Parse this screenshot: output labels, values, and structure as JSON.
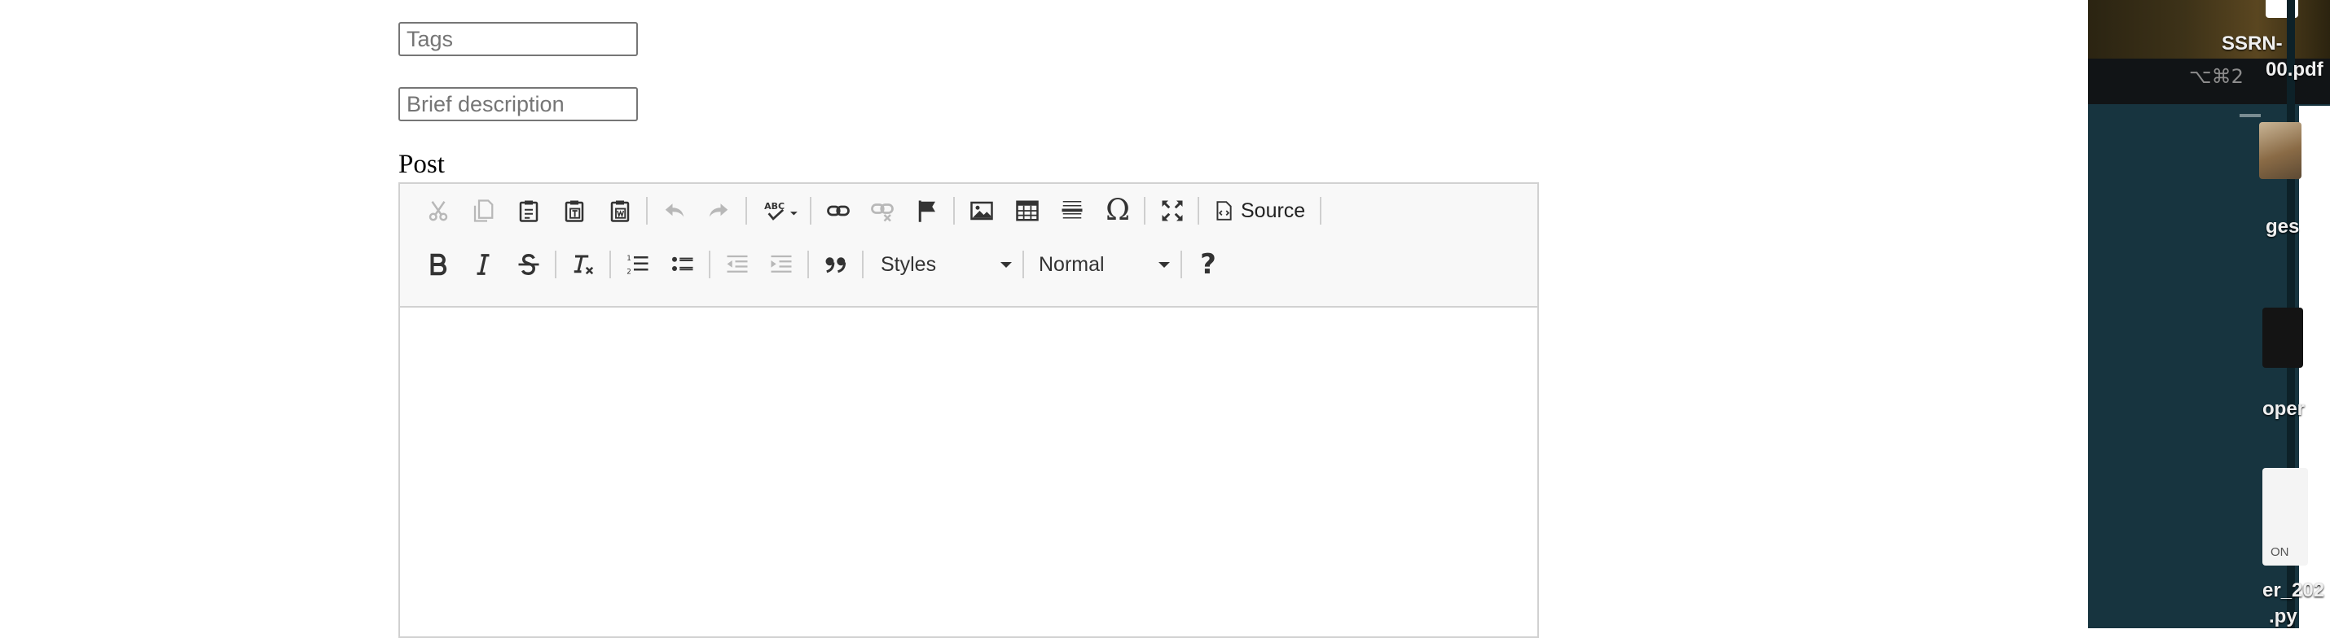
{
  "form": {
    "tags_placeholder": "Tags",
    "description_placeholder": "Brief description",
    "post_label": "Post"
  },
  "editor": {
    "toolbar_row1": [
      {
        "icon": "cut-icon",
        "disabled": true
      },
      {
        "icon": "copy-icon",
        "disabled": true
      },
      {
        "icon": "paste-icon",
        "disabled": false
      },
      {
        "icon": "paste-text-icon",
        "disabled": false
      },
      {
        "icon": "paste-from-word-icon",
        "disabled": false
      },
      {
        "icon": "undo-icon",
        "disabled": true
      },
      {
        "icon": "redo-icon",
        "disabled": true
      },
      {
        "icon": "spellcheck-icon",
        "disabled": false
      },
      {
        "icon": "link-icon",
        "disabled": false
      },
      {
        "icon": "unlink-icon",
        "disabled": true
      },
      {
        "icon": "anchor-flag-icon",
        "disabled": false
      },
      {
        "icon": "image-icon",
        "disabled": false
      },
      {
        "icon": "table-icon",
        "disabled": false
      },
      {
        "icon": "horizontal-line-icon",
        "disabled": false
      },
      {
        "icon": "special-character-icon",
        "disabled": false
      },
      {
        "icon": "maximize-icon",
        "disabled": false
      },
      {
        "icon": "source-icon",
        "disabled": false
      }
    ],
    "spellcheck_glyph": "ABC",
    "special_char_glyph": "Ω",
    "source_label": "Source",
    "toolbar_row2": [
      {
        "icon": "bold-icon"
      },
      {
        "icon": "italic-icon"
      },
      {
        "icon": "strikethrough-icon"
      },
      {
        "icon": "remove-format-icon"
      },
      {
        "icon": "numbered-list-icon"
      },
      {
        "icon": "bulleted-list-icon"
      },
      {
        "icon": "decrease-indent-icon",
        "disabled": true
      },
      {
        "icon": "increase-indent-icon",
        "disabled": true
      },
      {
        "icon": "blockquote-icon"
      },
      {
        "icon": "help-icon"
      }
    ],
    "styles_combo": "Styles",
    "format_combo": "Normal",
    "help_glyph": "?"
  },
  "desktop": {
    "file1_line1": "SSRN-",
    "file1_line2": "00.pdf",
    "shortcut": "⌥⌘2",
    "label_ges": "ges",
    "label_oper": "oper",
    "doc_badge": "ON",
    "file2_line1": "er_202",
    "file2_line2": ".py"
  },
  "colors": {
    "icon": "#333333",
    "toolbar_bg": "#f8f8f8",
    "border": "#d1d1d1",
    "desktop_bg": "#17343f"
  }
}
